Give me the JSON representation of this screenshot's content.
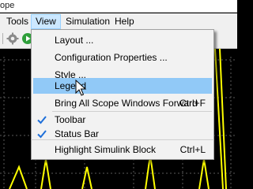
{
  "window": {
    "title_fragment": "ope"
  },
  "menubar": {
    "items": [
      {
        "label": "Tools",
        "open": false
      },
      {
        "label": "View",
        "open": true
      },
      {
        "label": "Simulation",
        "open": false
      },
      {
        "label": "Help",
        "open": false
      }
    ]
  },
  "toolbar": {
    "buttons": [
      "settings-gear-icon",
      "run-play-icon"
    ]
  },
  "view_menu": {
    "items": [
      {
        "label": "Layout ...",
        "shortcut": "",
        "checked": false,
        "highlighted": false
      },
      {
        "label": "Configuration Properties ...",
        "shortcut": "",
        "checked": false,
        "highlighted": false
      },
      {
        "label": "Style ...",
        "shortcut": "",
        "checked": false,
        "highlighted": false
      },
      {
        "label": "Legend",
        "shortcut": "",
        "checked": false,
        "highlighted": true
      },
      {
        "label": "Bring All Scope Windows Forward",
        "shortcut": "Ctrl+F",
        "checked": false,
        "highlighted": false
      },
      {
        "label": "Toolbar",
        "shortcut": "",
        "checked": true,
        "highlighted": false
      },
      {
        "label": "Status Bar",
        "shortcut": "",
        "checked": true,
        "highlighted": false
      },
      {
        "label": "Highlight Simulink Block",
        "shortcut": "Ctrl+L",
        "checked": false,
        "highlighted": false
      }
    ]
  },
  "colors": {
    "menu_highlight": "#91c9f7",
    "check_mark": "#1e6fd9",
    "scope_background": "#000000",
    "scope_grid": "#5a5a5a",
    "scope_signal": "#ffff00"
  }
}
